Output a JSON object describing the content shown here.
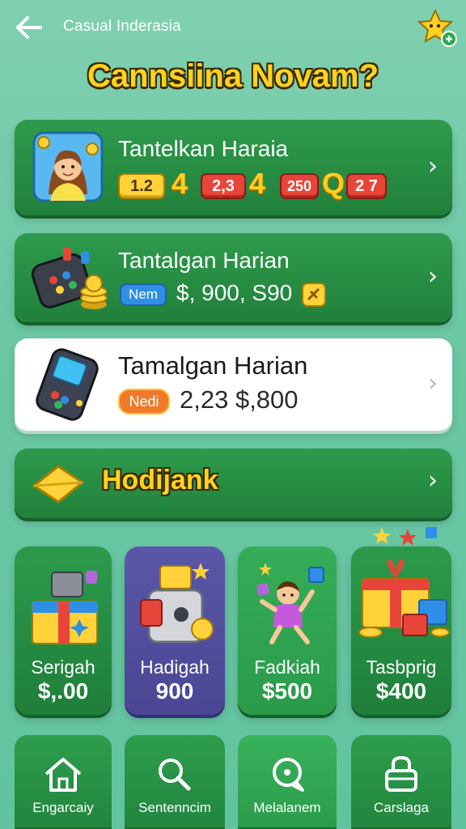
{
  "header": {
    "app_title": "Casual Inderasia",
    "headline": "Cannsiina Novam?"
  },
  "cards": [
    {
      "title": "Tantelkan Haraia",
      "chips": [
        "1.2",
        "4",
        "2,3",
        "4",
        "250",
        "Q",
        "2 7"
      ]
    },
    {
      "title": "Tantalgan Harian",
      "badge": "Nem",
      "amount": "$, 900, S90"
    },
    {
      "title": "Tamalgan Harian",
      "badge": "Nedi",
      "amount": "2,23  $,800"
    },
    {
      "title": "Hodijank"
    }
  ],
  "tiles": [
    {
      "label": "Serigah",
      "value": "$,.00"
    },
    {
      "label": "Hadigah",
      "value": "900"
    },
    {
      "label": "Fadkiah",
      "value": "$500"
    },
    {
      "label": "Tasbprig",
      "value": "$400"
    }
  ],
  "nav": [
    {
      "label": "Engarcaiy",
      "icon": "home-icon"
    },
    {
      "label": "Sentenncim",
      "icon": "search-icon"
    },
    {
      "label": "Melalanem",
      "icon": "chat-icon"
    },
    {
      "label": "Carslaga",
      "icon": "lock-icon"
    }
  ],
  "colors": {
    "background": "#6cc7a4",
    "card_green": "#2e9a4c",
    "headline_gold": "#ffd21f",
    "tile_purple": "#5b57a8"
  }
}
